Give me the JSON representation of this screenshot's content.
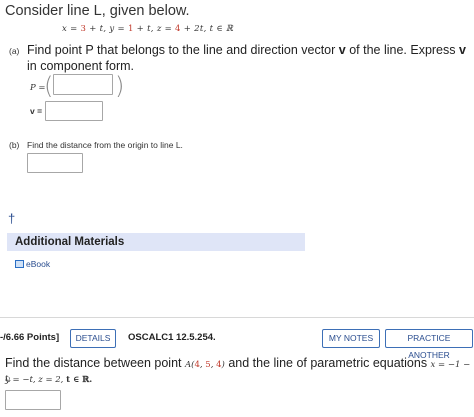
{
  "question1": {
    "intro": "Consider line L, given below.",
    "equation": {
      "x_prefix": "x = ",
      "x_const": "3",
      "x_rest": " + t,  ",
      "y_prefix": "y = ",
      "y_const": "1",
      "y_rest": " + t,  ",
      "z_prefix": "z = ",
      "z_const": "4",
      "z_rest": " + 2t,  ",
      "domain": "t ∈ ℝ"
    },
    "part_a": {
      "label": "(a)",
      "text_before": "Find point P that belongs to the line and direction vector ",
      "vector_symbol": "v",
      "text_after": " of the line. Express ",
      "vector_symbol_2": "v",
      "text_end": " in component form.",
      "p_label": "P =",
      "v_label": "v =",
      "paren_open": "(",
      "paren_close": ")",
      "p_value": "",
      "v_value": ""
    },
    "part_b": {
      "label": "(b)",
      "text": "Find the distance from the origin to line L.",
      "answer_value": ""
    },
    "dagger": "†",
    "additional_materials": {
      "title": "Additional Materials",
      "ebook_label": "eBook"
    }
  },
  "question2_header": {
    "points": "-/6.66 Points]",
    "details_button": "DETAILS",
    "reference": "OSCALC1 12.5.254.",
    "my_notes_button": "MY NOTES",
    "practice_button": "PRACTICE ANOTHER"
  },
  "question2": {
    "text_before": "Find the distance between point ",
    "point_name": "A(",
    "point_x": "4",
    "point_y": "5",
    "point_z": "4",
    "point_close": ")",
    "text_after": " and the line of parametric equations ",
    "eq_x": "x = −1 − t,",
    "eq_yz": "y = −t,  z = 2,  ",
    "domain": "t ∈ ℝ.",
    "answer_value": ""
  },
  "colors": {
    "accent_blue": "#2a4d8f",
    "button_border": "#3d6fb6",
    "header_bg": "#dfe5f7",
    "number_red": "#c0392b"
  }
}
